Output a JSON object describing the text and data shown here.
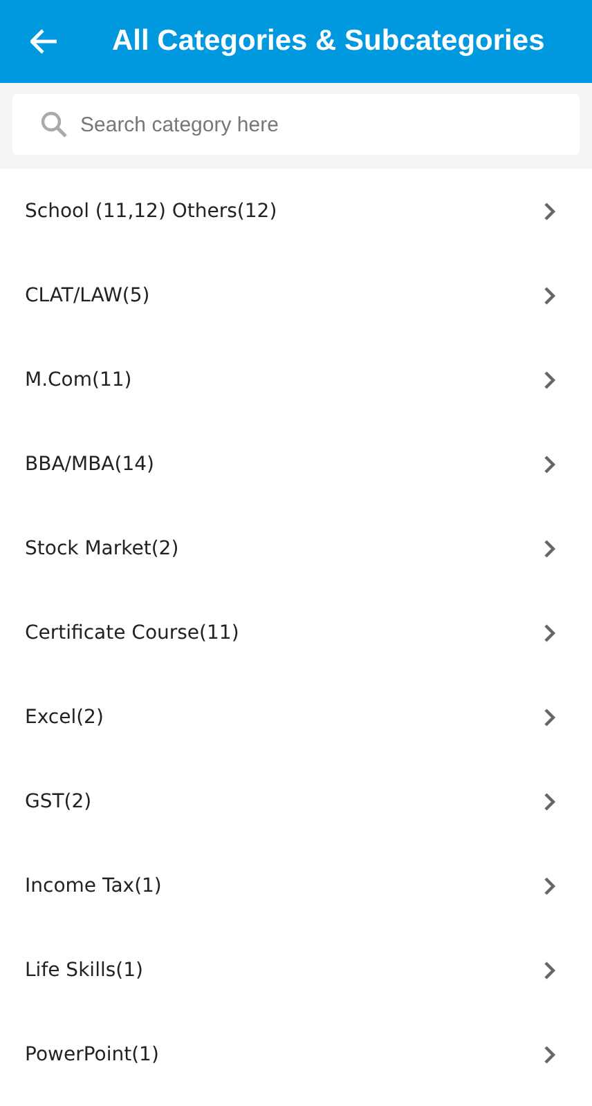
{
  "header": {
    "title": "All Categories & Subcategories"
  },
  "search": {
    "placeholder": "Search category here"
  },
  "categories": [
    {
      "label": "School (11,12) Others(12)"
    },
    {
      "label": "CLAT/LAW(5)"
    },
    {
      "label": "M.Com(11)"
    },
    {
      "label": "BBA/MBA(14)"
    },
    {
      "label": "Stock Market(2)"
    },
    {
      "label": "Certificate Course(11)"
    },
    {
      "label": "Excel(2)"
    },
    {
      "label": "GST(2)"
    },
    {
      "label": "Income Tax(1)"
    },
    {
      "label": "Life Skills(1)"
    },
    {
      "label": "PowerPoint(1)"
    }
  ]
}
